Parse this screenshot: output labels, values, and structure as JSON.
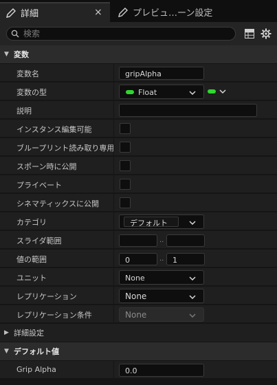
{
  "tabs": [
    {
      "label": "詳細",
      "active": true,
      "icon": "pencil-icon"
    },
    {
      "label": "プレビュ…ーン設定",
      "active": false,
      "icon": "pencil-icon"
    }
  ],
  "tab_close": "×",
  "search": {
    "placeholder": "検索",
    "value": ""
  },
  "sections": {
    "variables": "変数",
    "advanced": "詳細設定",
    "default_value": "デフォルト値"
  },
  "props": {
    "var_name": {
      "label": "変数名",
      "value": "gripAlpha"
    },
    "var_type": {
      "label": "変数の型",
      "value": "Float",
      "pin_color": "#2fd72f"
    },
    "description": {
      "label": "説明",
      "value": ""
    },
    "instance_editable": {
      "label": "インスタンス編集可能",
      "checked": false
    },
    "blueprint_readonly": {
      "label": "ブループリント読み取り専用",
      "checked": false
    },
    "expose_on_spawn": {
      "label": "スポーン時に公開",
      "checked": false
    },
    "private": {
      "label": "プライベート",
      "checked": false
    },
    "expose_cinematics": {
      "label": "シネマティックスに公開",
      "checked": false
    },
    "category": {
      "label": "カテゴリ",
      "value": "デフォルト"
    },
    "slider_range": {
      "label": "スライダ範囲",
      "min": "",
      "max": "",
      "sep": ".."
    },
    "value_range": {
      "label": "値の範囲",
      "min": "0",
      "max": "1",
      "sep": ".."
    },
    "units": {
      "label": "ユニット",
      "value": "None"
    },
    "replication": {
      "label": "レプリケーション",
      "value": "None"
    },
    "replication_condition": {
      "label": "レプリケーション条件",
      "value": "None"
    },
    "grip_alpha": {
      "label": "Grip Alpha",
      "value": "0.0"
    }
  }
}
